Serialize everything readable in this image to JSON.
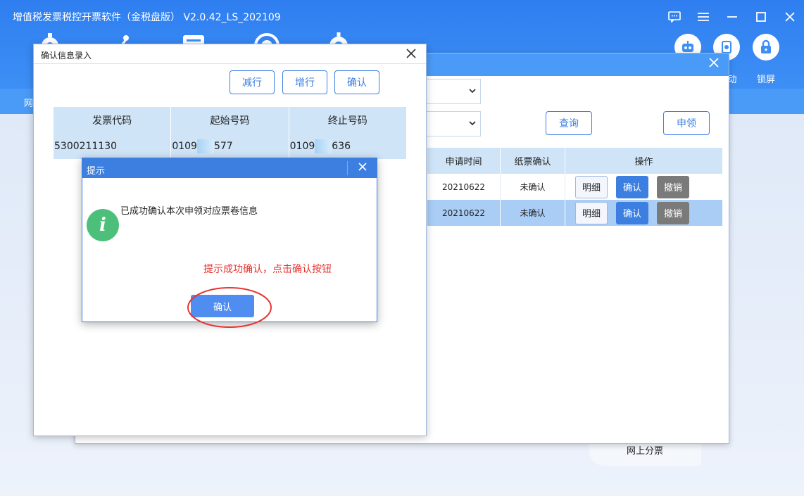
{
  "app": {
    "title": "增值税发票税控开票软件（金税盘版） V2.0.42_LS_202109"
  },
  "toolbar": {
    "right_tools": [
      {
        "label": "动",
        "icon": "robot-icon"
      },
      {
        "label": "",
        "icon": "gear-chip-icon"
      },
      {
        "label": "锁屏",
        "icon": "lock-icon"
      }
    ]
  },
  "nav": {
    "first_item": "网"
  },
  "side_card": {
    "label": "网上分票"
  },
  "bg_dialog": {
    "query_label": "查询",
    "apply_label": "申领",
    "table": {
      "headers": [
        "申请时间",
        "纸票确认",
        "操作"
      ],
      "rows": [
        {
          "date": "20210622",
          "status": "未确认",
          "detail": "明细",
          "confirm": "确认",
          "revoke": "撤销"
        },
        {
          "date": "20210622",
          "status": "未确认",
          "detail": "明细",
          "confirm": "确认",
          "revoke": "撤销"
        }
      ]
    }
  },
  "front_dialog": {
    "title": "确认信息录入",
    "buttons": {
      "remove": "减行",
      "add": "增行",
      "confirm": "确认"
    },
    "table": {
      "headers": [
        "发票代码",
        "起始号码",
        "终止号码"
      ],
      "row": {
        "code": "5300211130",
        "start_prefix": "0109",
        "start_suffix": "577",
        "end_prefix": "0109",
        "end_suffix": "636"
      }
    }
  },
  "tip": {
    "title": "提示",
    "message": "已成功确认本次申领对应票卷信息",
    "ok_label": "确认"
  },
  "annotation": "提示成功确认，点击确认按钮",
  "colors": {
    "title_blue": "#2f7ef0",
    "accent": "#3d7fe0",
    "annotation_red": "#e8342f",
    "info_green": "#4cbf7a"
  }
}
